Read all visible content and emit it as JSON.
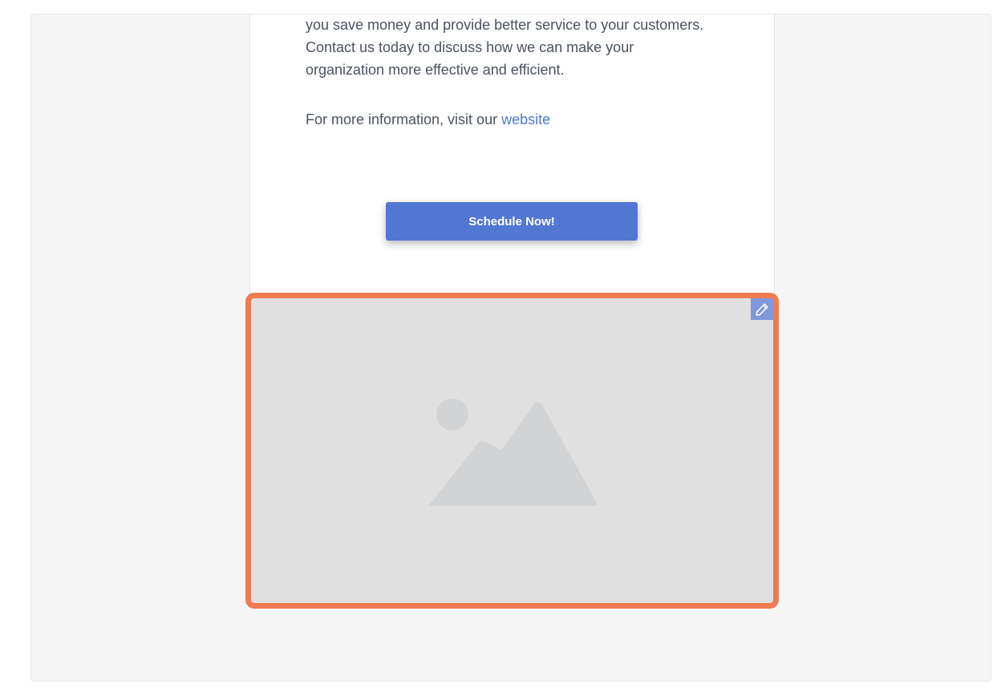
{
  "email": {
    "paragraph_lines": [
      "you save money and provide better service to your customers.",
      "Contact us today to discuss how we can make your",
      "organization more effective and efficient."
    ],
    "more_info_text": "For more information, visit our ",
    "more_info_link": "website",
    "cta_label": "Schedule Now!"
  },
  "image_block": {
    "edit_icon": "pencil-icon",
    "placeholder_icon": "image-placeholder-icon"
  },
  "colors": {
    "accent": "#5177d3",
    "selection_border": "#ee7b52",
    "link": "#4f78d4"
  }
}
